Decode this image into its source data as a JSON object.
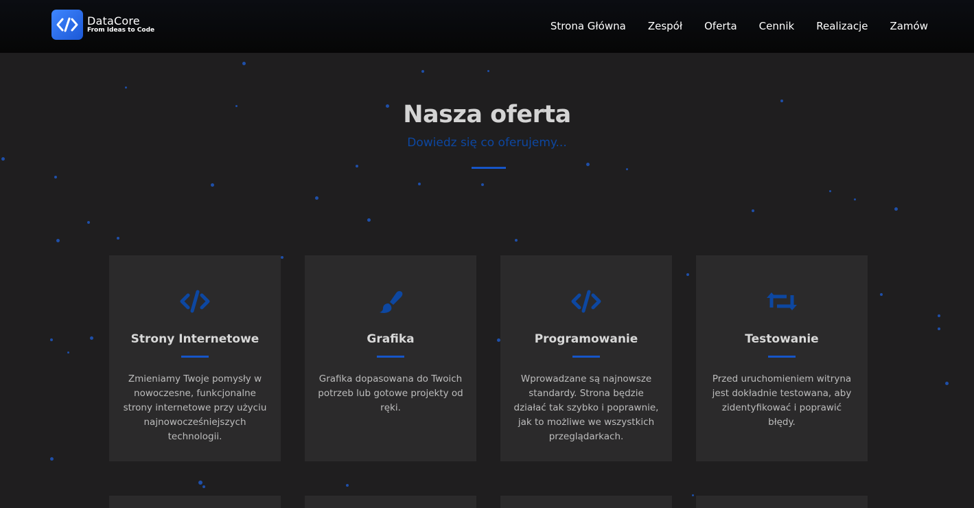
{
  "header": {
    "logo": {
      "name": "DataCore",
      "tagline": "From Ideas to Code",
      "mark": "</>"
    },
    "nav": [
      {
        "label": "Strona Główna"
      },
      {
        "label": "Zespół"
      },
      {
        "label": "Oferta"
      },
      {
        "label": "Cennik"
      },
      {
        "label": "Realizacje"
      },
      {
        "label": "Zamów"
      }
    ]
  },
  "section": {
    "title": "Nasza oferta",
    "subtitle": "Dowiedz się co oferujemy..."
  },
  "cards": [
    {
      "icon": "code-icon",
      "title": "Strony Internetowe",
      "text": "Zmieniamy Twoje pomysły w nowoczesne, funkcjonalne strony internetowe przy użyciu najnowocześniejszych technologii."
    },
    {
      "icon": "paint-brush-icon",
      "title": "Grafika",
      "text": "Grafika dopasowana do Twoich potrzeb lub gotowe projekty od ręki."
    },
    {
      "icon": "code-icon",
      "title": "Programowanie",
      "text": "Wprowadzane są najnowsze standardy. Strona będzie działać tak szybko i poprawnie, jak to możliwe we wszystkich przeglądarkach."
    },
    {
      "icon": "retweet-icon",
      "title": "Testowanie",
      "text": "Przed uruchomieniem witryna jest dokładnie testowana, aby zidentyfikować i poprawić błędy."
    }
  ],
  "colors": {
    "accent": "#1655c8",
    "subtitle": "#0d47a1",
    "background": "#1f1e1f",
    "card": "#2b2a2b",
    "header": "#070707"
  }
}
